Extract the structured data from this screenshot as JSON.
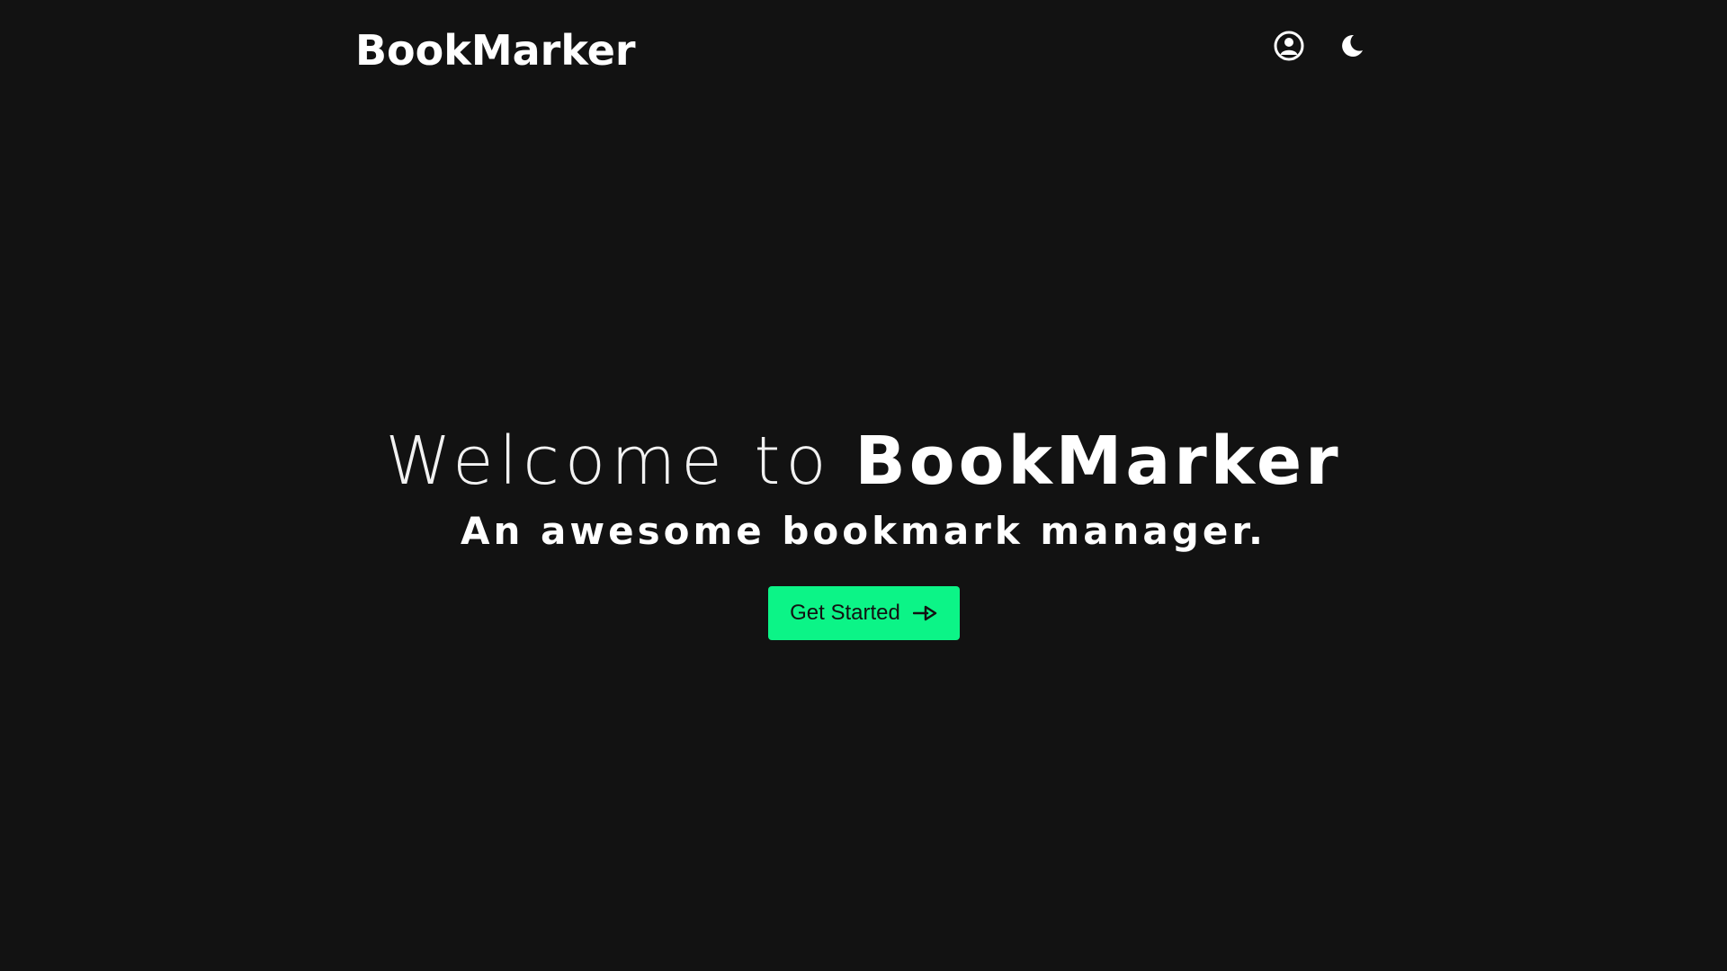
{
  "header": {
    "logo": "BookMarker",
    "user_icon": "user-circle-icon",
    "theme_icon": "moon-icon"
  },
  "hero": {
    "title_prefix": "Welcome to",
    "title_brand": "BookMarker",
    "subtitle": "An awesome bookmark manager.",
    "cta_label": "Get Started",
    "cta_icon": "arrow-right-icon"
  },
  "colors": {
    "background": "#121212",
    "text": "#ffffff",
    "accent": "#0cf487"
  }
}
